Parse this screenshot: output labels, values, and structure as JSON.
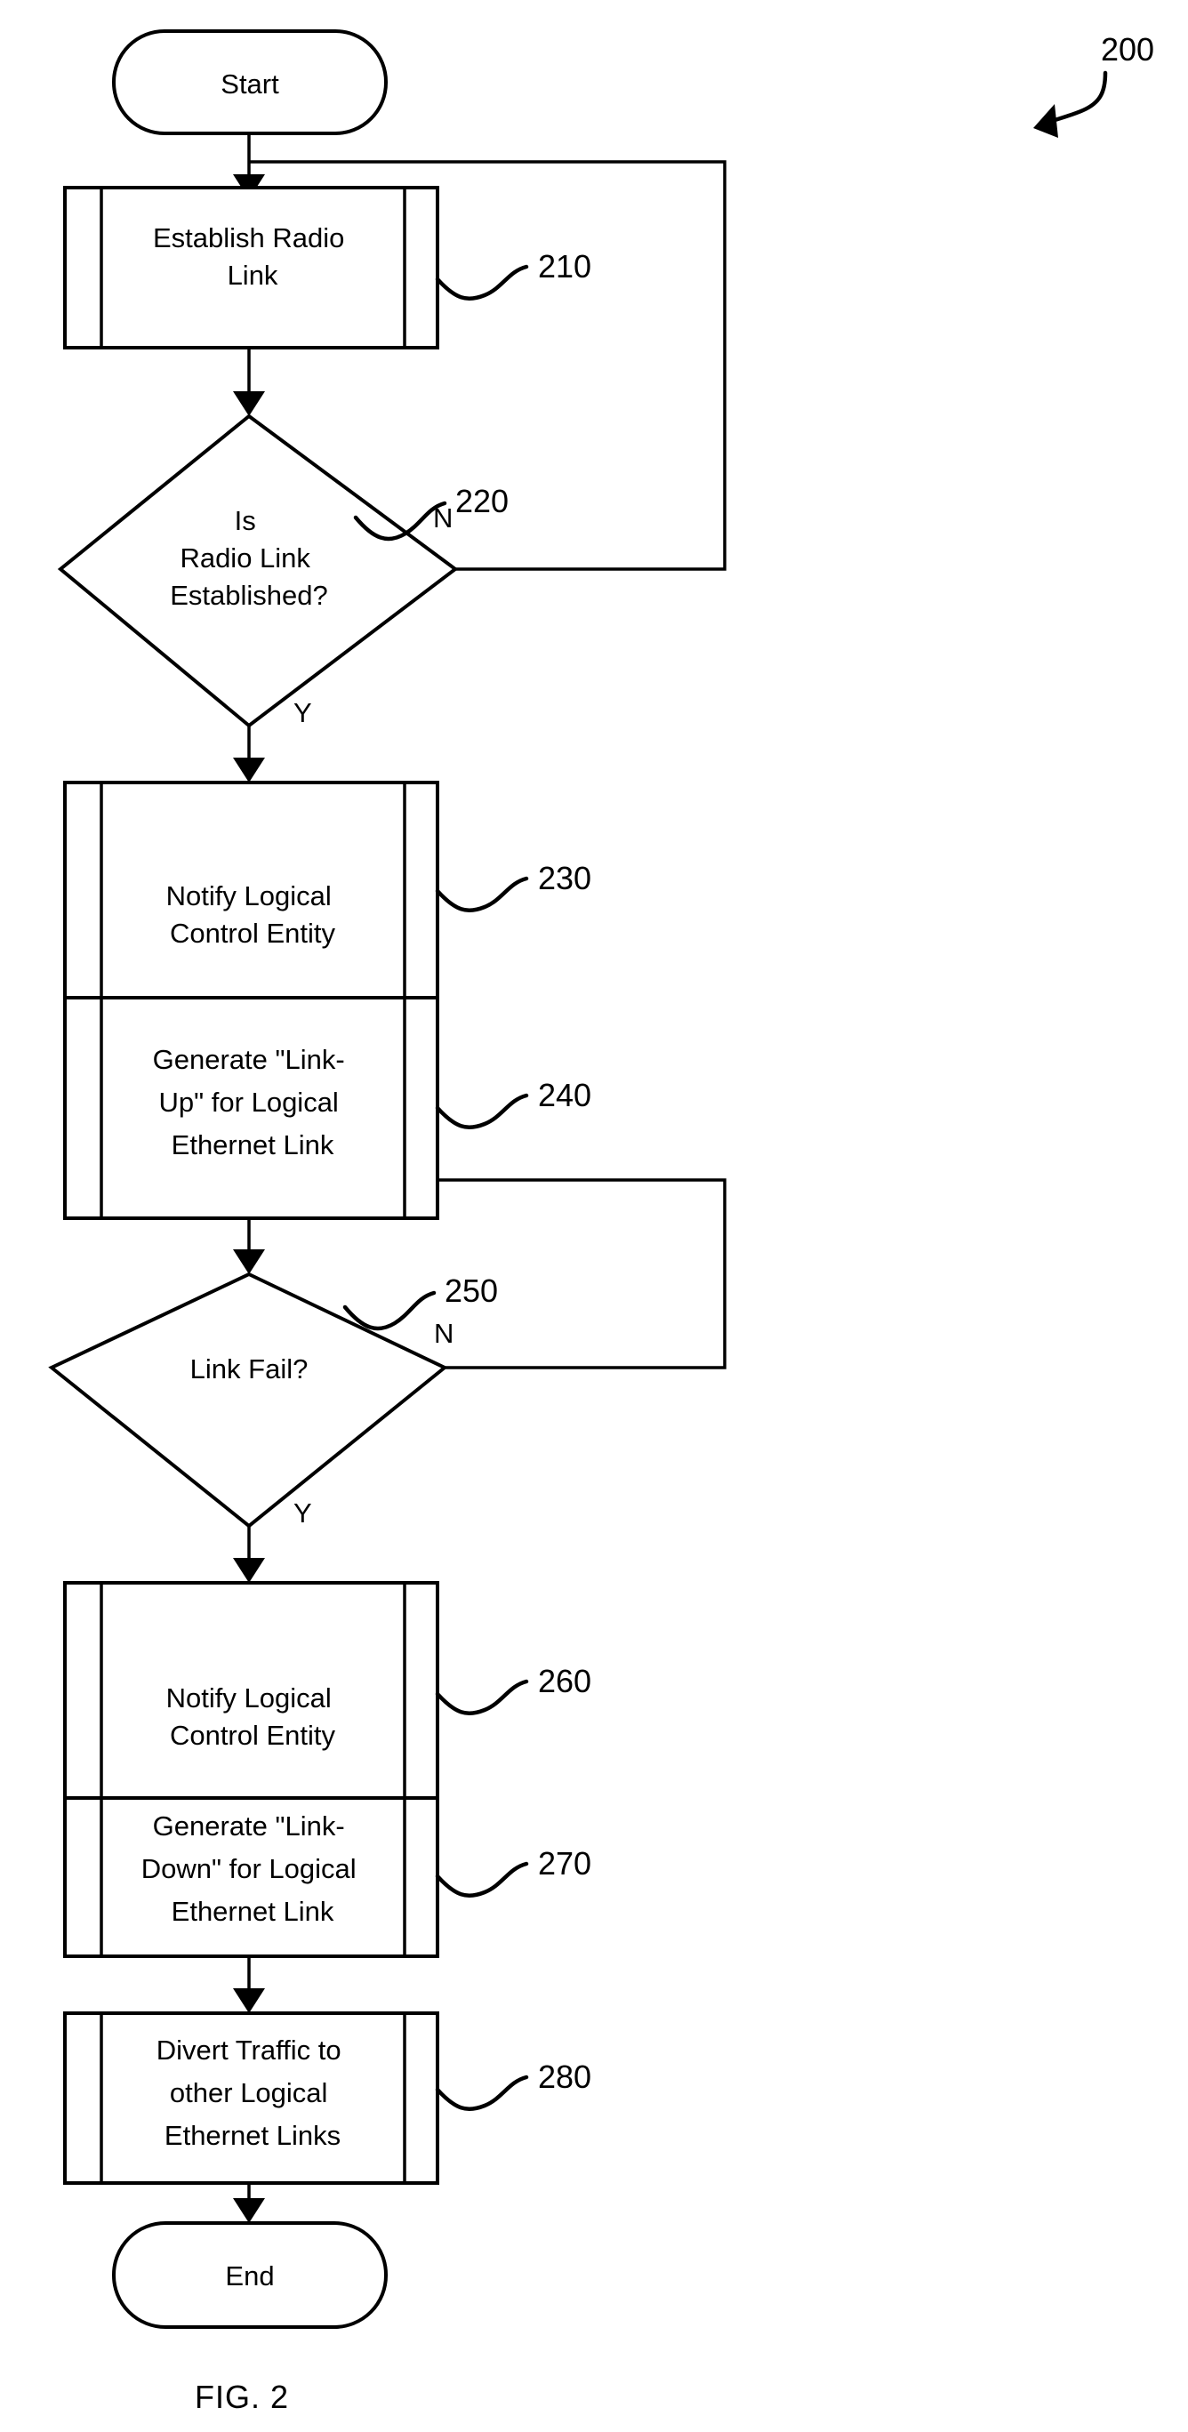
{
  "figure": {
    "caption": "FIG. 2",
    "reference_number": "200"
  },
  "nodes": {
    "start": {
      "label": "Start",
      "type": "terminator"
    },
    "end": {
      "label": "End",
      "type": "terminator"
    },
    "step210": {
      "ref": "210",
      "type": "predefined-process",
      "lines": [
        "Establish Radio",
        "Link"
      ]
    },
    "decision220": {
      "ref": "220",
      "type": "decision",
      "lines": [
        "Is",
        "Radio Link",
        "Established?"
      ],
      "yes_label": "Y",
      "no_label": "N"
    },
    "step230": {
      "ref": "230",
      "type": "predefined-process",
      "lines": [
        "Notify Logical",
        "Control Entity"
      ]
    },
    "step240": {
      "ref": "240",
      "type": "predefined-process",
      "lines": [
        "Generate \"Link-",
        "Up\" for Logical",
        "Ethernet Link"
      ]
    },
    "decision250": {
      "ref": "250",
      "type": "decision",
      "lines": [
        "Link Fail?"
      ],
      "yes_label": "Y",
      "no_label": "N"
    },
    "step260": {
      "ref": "260",
      "type": "predefined-process",
      "lines": [
        "Notify Logical",
        "Control Entity"
      ]
    },
    "step270": {
      "ref": "270",
      "type": "predefined-process",
      "lines": [
        "Generate \"Link-",
        "Down\" for Logical",
        "Ethernet Link"
      ]
    },
    "step280": {
      "ref": "280",
      "type": "predefined-process",
      "lines": [
        "Divert Traffic to",
        "other Logical",
        "Ethernet Links"
      ]
    }
  },
  "colors": {
    "ink": "#000000",
    "paper": "#ffffff"
  }
}
